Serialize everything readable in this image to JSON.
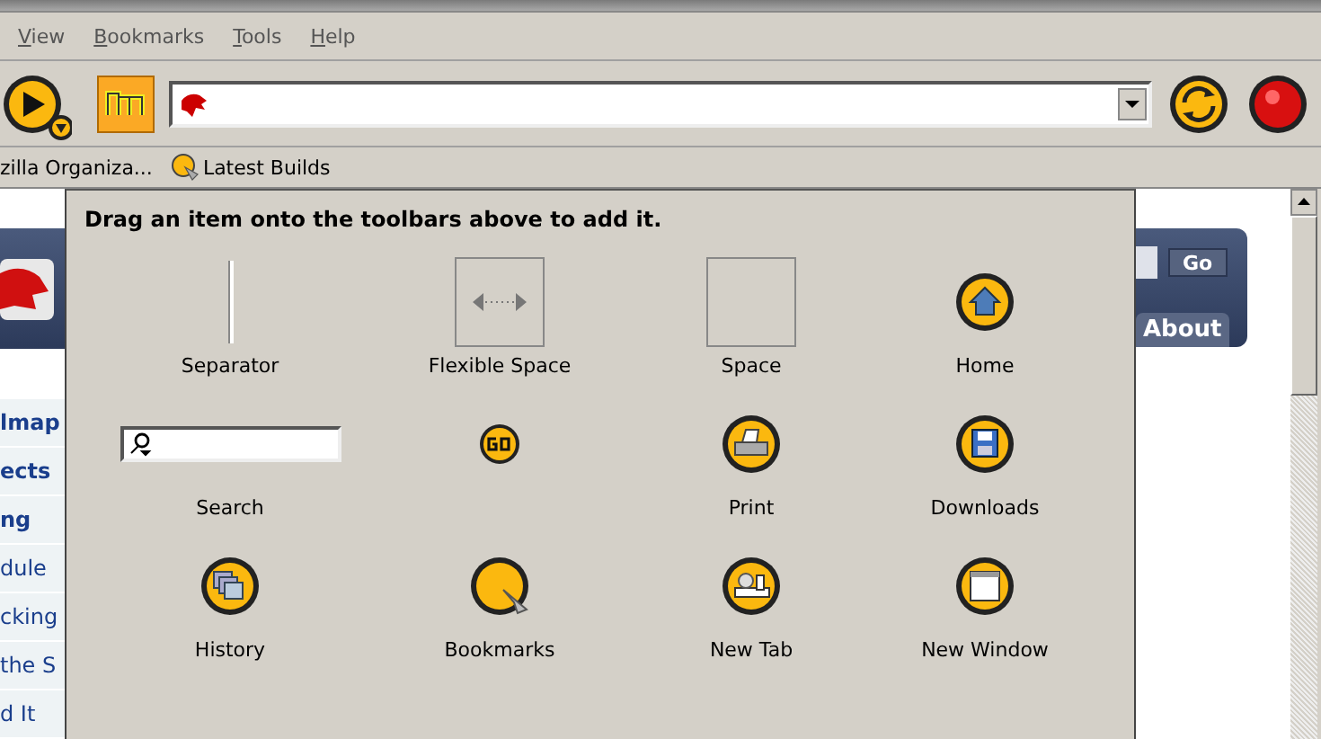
{
  "menu": [
    {
      "label": "View"
    },
    {
      "label": "Bookmarks"
    },
    {
      "label": "Tools"
    },
    {
      "label": "Help"
    }
  ],
  "bookmarks": [
    {
      "label": "zilla Organiza...",
      "kind": "plain"
    },
    {
      "label": "Latest Builds",
      "kind": "bookmark"
    }
  ],
  "page": {
    "links": [
      {
        "label": "lmap",
        "bold": true
      },
      {
        "label": "ects",
        "bold": true
      },
      {
        "label": "ng",
        "bold": true
      },
      {
        "label": "dule",
        "bold": false
      },
      {
        "label": "cking",
        "bold": false
      },
      {
        "label": "the S",
        "bold": false
      },
      {
        "label": "d It",
        "bold": false
      }
    ],
    "go_button": "Go",
    "tab": "About"
  },
  "palette": {
    "instruction": "Drag an item onto the toolbars above to add it.",
    "items": [
      {
        "kind": "separator",
        "label": "Separator"
      },
      {
        "kind": "flexible-space",
        "label": "Flexible Space"
      },
      {
        "kind": "space",
        "label": "Space"
      },
      {
        "kind": "home",
        "label": "Home"
      },
      {
        "kind": "search",
        "label": "Search"
      },
      {
        "kind": "go"
      },
      {
        "kind": "print",
        "label": "Print"
      },
      {
        "kind": "downloads",
        "label": "Downloads"
      },
      {
        "kind": "history",
        "label": "History"
      },
      {
        "kind": "bookmarks",
        "label": "Bookmarks"
      },
      {
        "kind": "new-tab",
        "label": "New Tab"
      },
      {
        "kind": "new-window",
        "label": "New Window"
      }
    ]
  }
}
